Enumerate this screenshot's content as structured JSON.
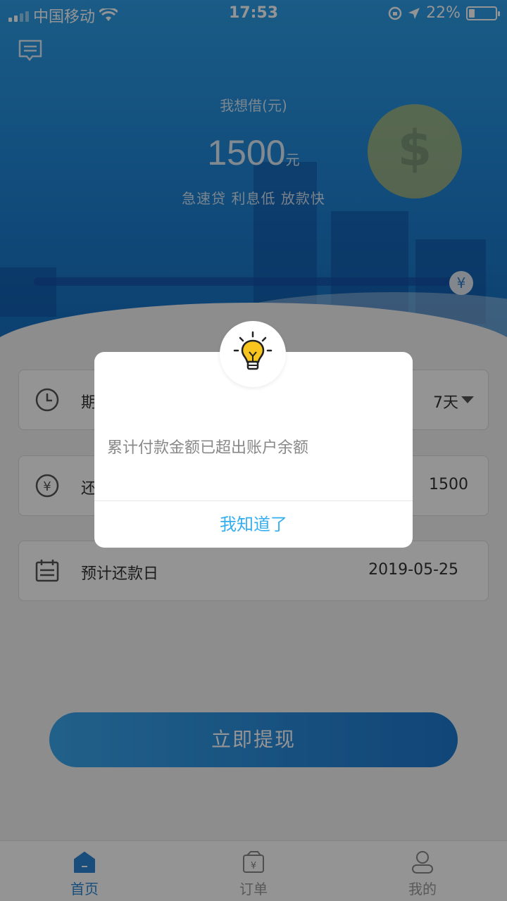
{
  "status_bar": {
    "carrier": "中国移动",
    "time": "17:53",
    "battery": "22%",
    "battery_level": 0.22
  },
  "hero": {
    "label": "我想借(元)",
    "amount": "1500",
    "unit": "元",
    "slogan": "急速贷 利息低 放款快",
    "slider_symbol": "¥"
  },
  "form": {
    "term": {
      "label": "期",
      "value": "7天",
      "icon": "clock-icon"
    },
    "repay": {
      "label": "还",
      "value": "1500",
      "icon": "yen-circle-icon"
    },
    "date": {
      "label": "预计还款日",
      "value": "2019-05-25",
      "icon": "calendar-icon"
    }
  },
  "withdraw_button": "立即提现",
  "tabs": [
    {
      "label": "首页",
      "icon": "home-icon",
      "active": true
    },
    {
      "label": "订单",
      "icon": "order-icon",
      "active": false
    },
    {
      "label": "我的",
      "icon": "user-icon",
      "active": false
    }
  ],
  "dialog": {
    "message": "累计付款金额已超出账户余额",
    "button": "我知道了",
    "icon": "lightbulb-icon"
  },
  "colors": {
    "accent": "#2a85d6",
    "dialog_button": "#35aef0",
    "bulb": "#f7c51e"
  }
}
